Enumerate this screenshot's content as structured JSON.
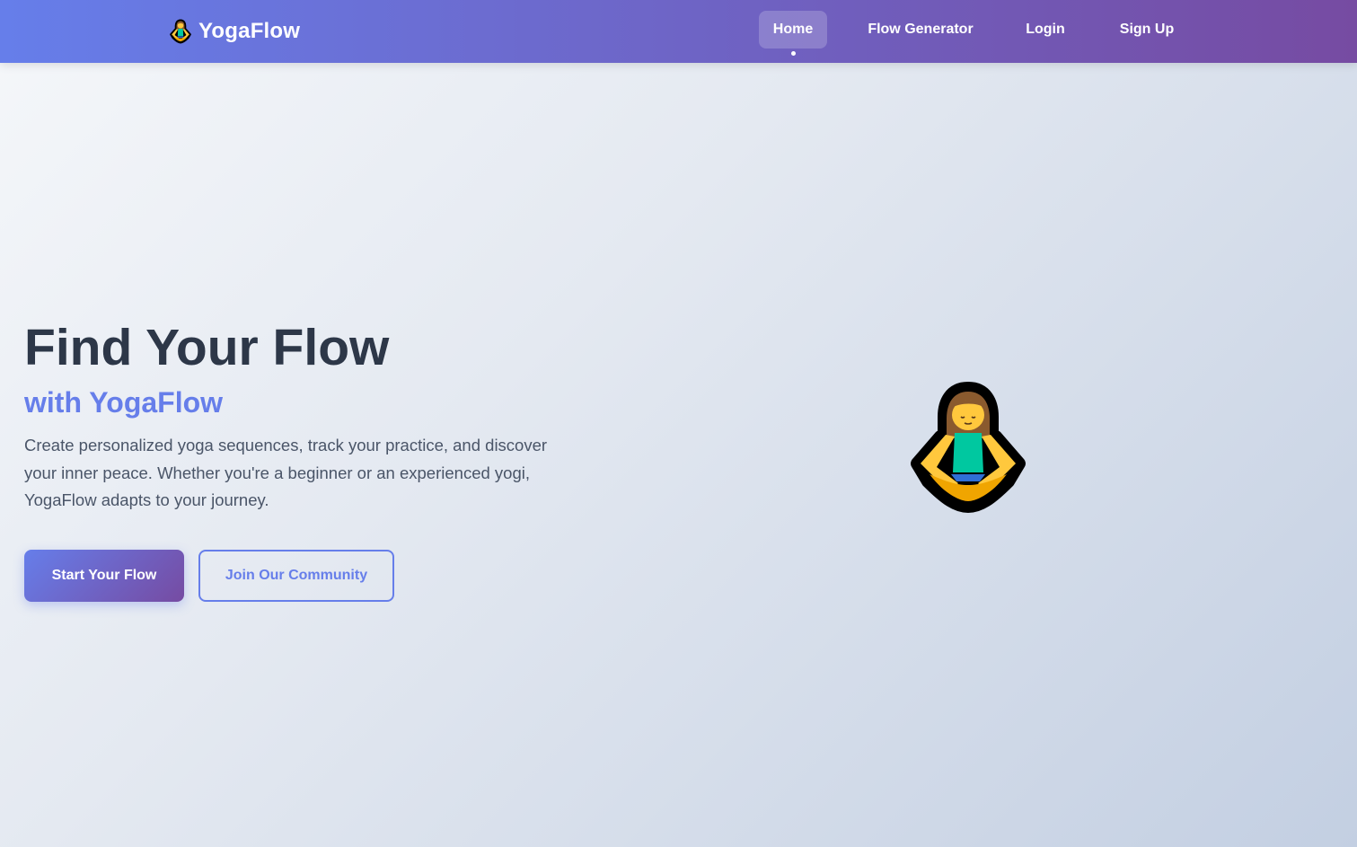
{
  "brand": {
    "name": "YogaFlow",
    "icon": "person-in-lotus-position-icon"
  },
  "nav": {
    "items": [
      {
        "label": "Home",
        "active": true
      },
      {
        "label": "Flow Generator",
        "active": false
      },
      {
        "label": "Login",
        "active": false
      },
      {
        "label": "Sign Up",
        "active": false
      }
    ]
  },
  "hero": {
    "title": "Find Your Flow",
    "subtitle": "with YogaFlow",
    "description": "Create personalized yoga sequences, track your practice, and discover your inner peace. Whether you're a beginner or an experienced yogi, YogaFlow adapts to your journey.",
    "primary_button": "Start Your Flow",
    "secondary_button": "Join Our Community",
    "illustration": "person-in-lotus-position-icon"
  },
  "colors": {
    "accent": "#667eea",
    "accent_end": "#764ba2",
    "heading": "#2d3748",
    "body_text": "#4a5568"
  }
}
